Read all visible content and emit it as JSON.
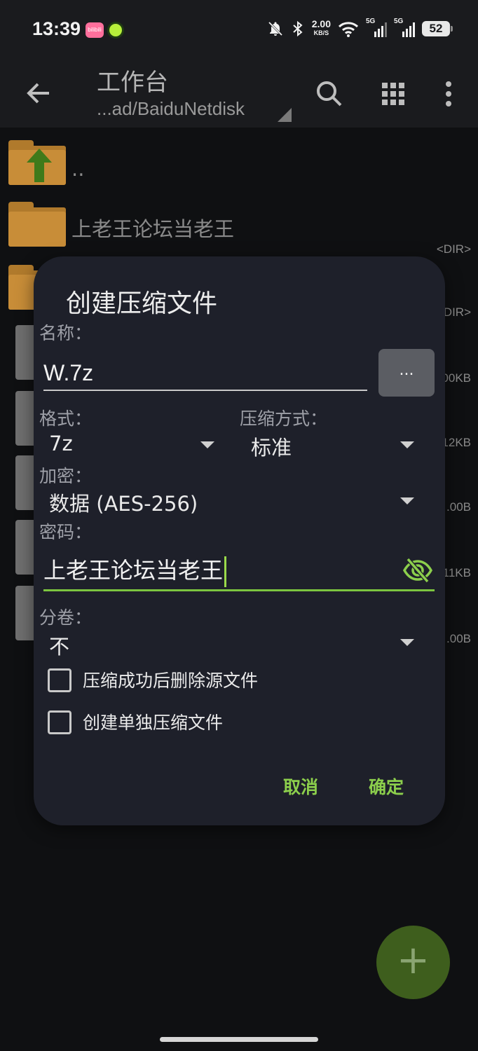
{
  "status_bar": {
    "time": "13:39",
    "app_icon_1": "bilibili",
    "net_speed_value": "2.00",
    "net_speed_unit": "KB/S",
    "signal_1_label": "5G",
    "signal_2_label": "5G",
    "battery": "52",
    "icons": [
      "bell-off-icon",
      "bluetooth-icon",
      "wifi-icon",
      "signal-icon",
      "signal-icon",
      "battery-icon"
    ]
  },
  "app_bar": {
    "title": "工作台",
    "path": "...ad/BaiduNetdisk",
    "icons": [
      "back-arrow-icon",
      "search-icon",
      "grid-icon",
      "more-vert-icon"
    ]
  },
  "file_list": {
    "items": [
      {
        "name": "..",
        "meta": "",
        "type": "parent-folder"
      },
      {
        "name": "上老王论坛当老王",
        "meta": "<DIR>",
        "type": "folder"
      },
      {
        "name": "",
        "meta": "<DIR>",
        "type": "folder"
      },
      {
        "name": "",
        "meta": "00KB",
        "type": "file"
      },
      {
        "name": "",
        "meta": "12KB",
        "type": "file"
      },
      {
        "name": "",
        "meta": ".00B",
        "type": "file"
      },
      {
        "name": "",
        "meta": ".11KB",
        "type": "file"
      },
      {
        "name": "",
        "meta": ".00B",
        "type": "file"
      }
    ]
  },
  "dialog": {
    "title": "创建压缩文件",
    "name_label": "名称：",
    "name_value": "W.7z",
    "browse_label": "...",
    "format_label": "格式：",
    "format_value": "7z",
    "compression_label": "压缩方式：",
    "compression_value": "标准",
    "encryption_label": "加密：",
    "encryption_value": "数据 (AES-256)",
    "password_label": "密码：",
    "password_value": "上老王论坛当老王",
    "split_label": "分卷：",
    "split_value": "不",
    "checkbox_delete_label": "压缩成功后删除源文件",
    "checkbox_delete_checked": false,
    "checkbox_separate_label": "创建单独压缩文件",
    "checkbox_separate_checked": false,
    "cancel_label": "取消",
    "ok_label": "确定",
    "accent_color": "#8ccf4c"
  },
  "fab": {
    "label": "+"
  }
}
